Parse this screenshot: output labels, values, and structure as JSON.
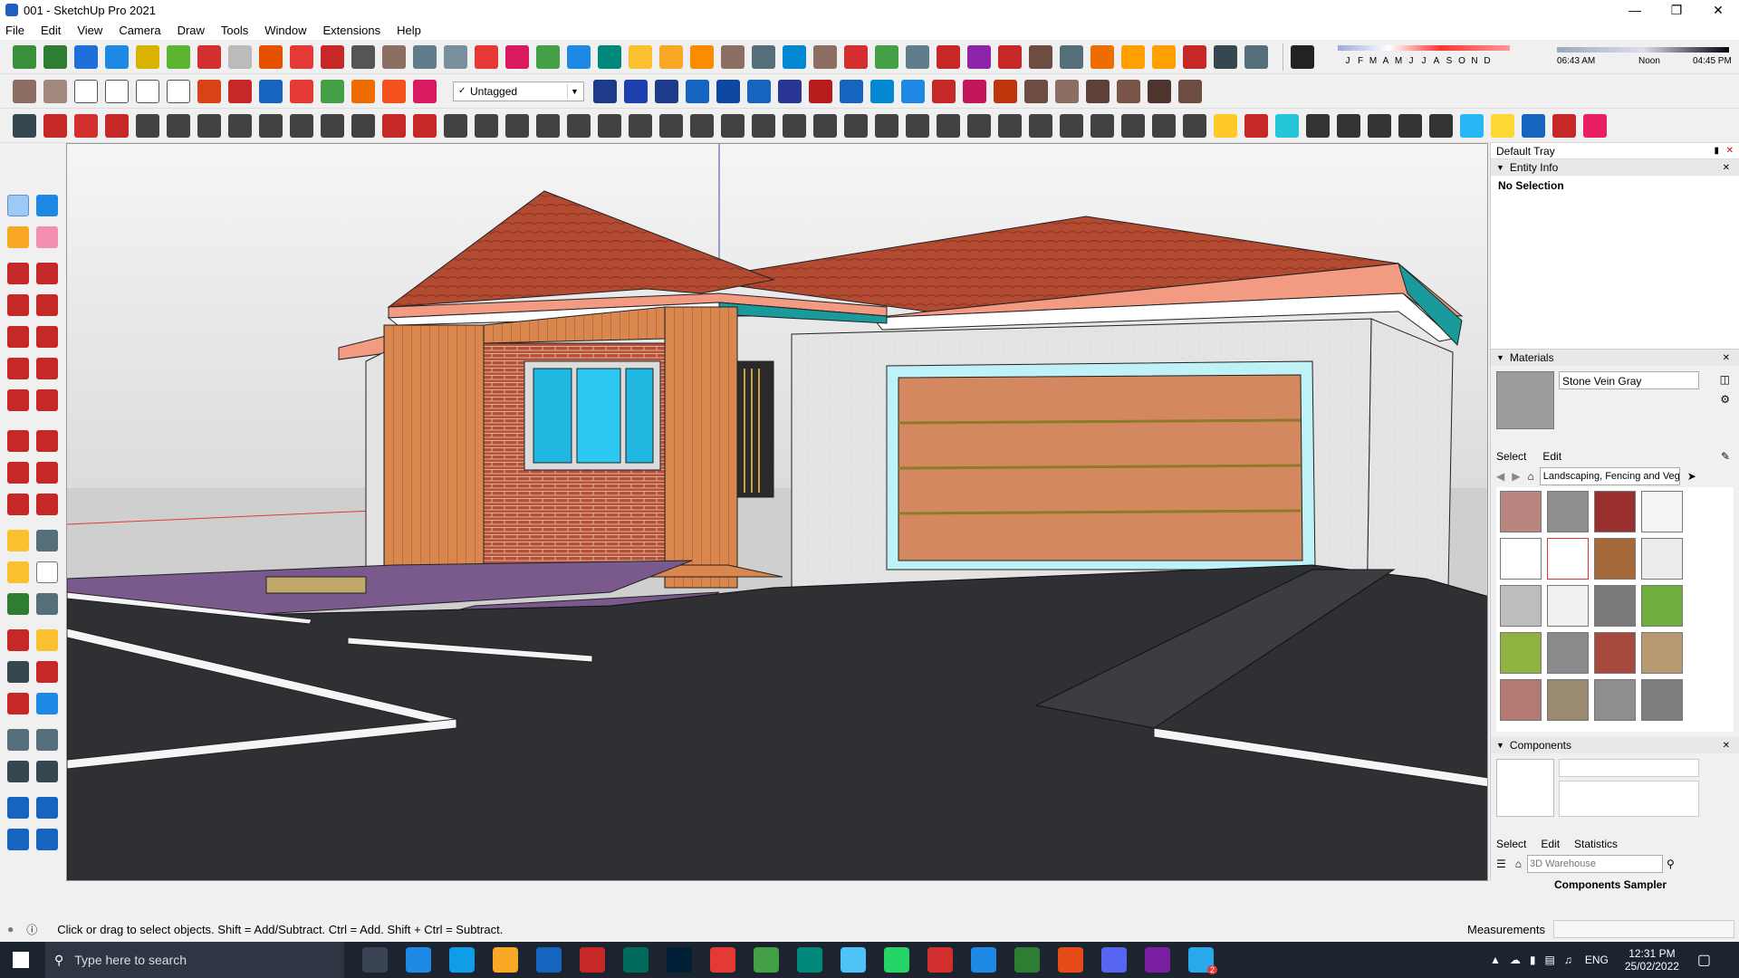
{
  "window": {
    "title": "001 - SketchUp Pro 2021"
  },
  "menu": [
    "File",
    "Edit",
    "View",
    "Camera",
    "Draw",
    "Tools",
    "Window",
    "Extensions",
    "Help"
  ],
  "tag_selector": {
    "value": "Untagged"
  },
  "shadows": {
    "months": [
      "J",
      "F",
      "M",
      "A",
      "M",
      "J",
      "J",
      "A",
      "S",
      "O",
      "N",
      "D"
    ],
    "time_start": "06:43 AM",
    "time_mid": "Noon",
    "time_end": "04:45 PM"
  },
  "tray": {
    "title": "Default Tray",
    "entity_info": {
      "label": "Entity Info",
      "selection": "No Selection"
    },
    "materials": {
      "label": "Materials",
      "current": "Stone Vein Gray",
      "tabs": [
        "Select",
        "Edit"
      ],
      "library": "Landscaping, Fencing and Vegetation"
    },
    "components": {
      "label": "Components",
      "tabs": [
        "Select",
        "Edit",
        "Statistics"
      ],
      "search_placeholder": "3D Warehouse",
      "sampler": "Components Sampler"
    }
  },
  "status": {
    "message": "Click or drag to select objects. Shift = Add/Subtract. Ctrl = Add. Shift + Ctrl = Subtract.",
    "measurements_label": "Measurements"
  },
  "taskbar": {
    "search_placeholder": "Type here to search",
    "language": "ENG",
    "time": "12:31 PM",
    "date": "25/02/2022",
    "notification_count": "2"
  }
}
